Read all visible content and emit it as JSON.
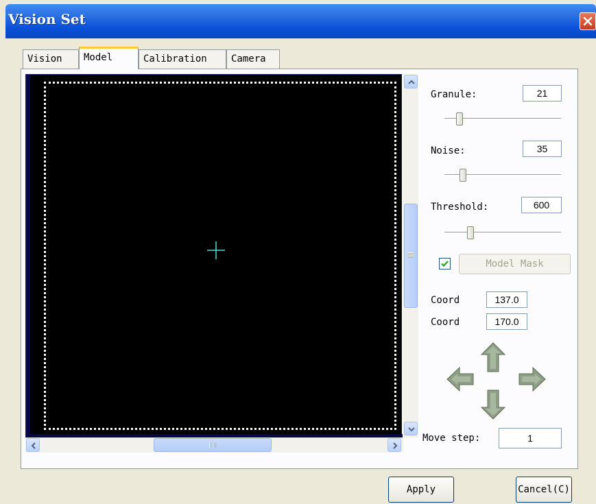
{
  "window": {
    "title": "Vision Set"
  },
  "tabs": [
    {
      "label": "Vision"
    },
    {
      "label": "Model"
    },
    {
      "label": "Calibration"
    },
    {
      "label": "Camera"
    }
  ],
  "active_tab": "Model",
  "panel": {
    "granule": {
      "label": "Granule:",
      "value": "21"
    },
    "noise": {
      "label": "Noise:",
      "value": "35"
    },
    "threshold": {
      "label": "Threshold:",
      "value": "600"
    },
    "model_mask": {
      "label": "Model Mask",
      "checked": true,
      "enabled": false
    },
    "coord_1": {
      "label": "Coord",
      "value": "137.0"
    },
    "coord_2": {
      "label": "Coord",
      "value": "170.0"
    },
    "move_step": {
      "label": "Move step:",
      "value": "1"
    }
  },
  "buttons": {
    "apply": "Apply",
    "cancel": "Cancel(C)"
  },
  "icons": {
    "close": "close-icon",
    "up": "arrow-up-icon",
    "down": "arrow-down-icon",
    "left": "arrow-left-icon",
    "right": "arrow-right-icon",
    "crosshair": "crosshair-icon"
  },
  "colors": {
    "title_bar": "#0a50d8",
    "image_background": "#000000",
    "crosshair": "#4fe3d3",
    "tab_highlight": "#ffc83c",
    "arrow_fill": "#8d9e84"
  }
}
